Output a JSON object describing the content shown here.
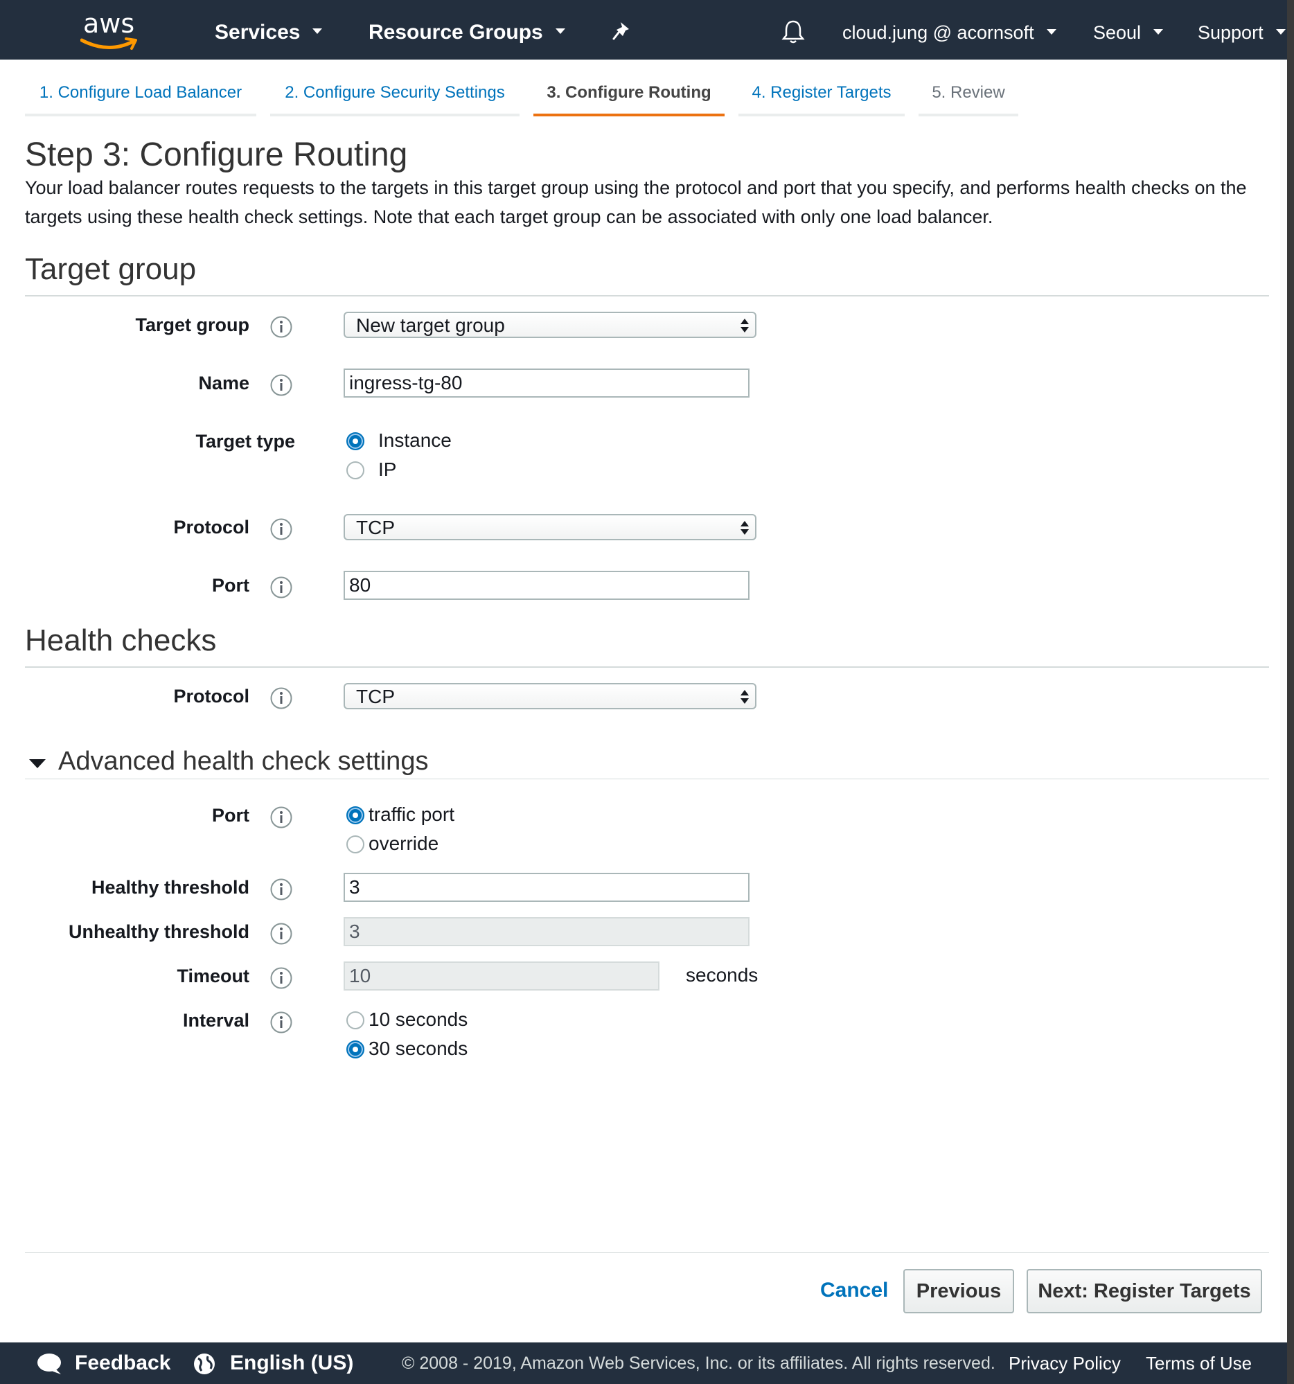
{
  "nav": {
    "logo": "aws",
    "services": "Services",
    "resource_groups": "Resource Groups",
    "account": "cloud.jung @ acornsoft",
    "region": "Seoul",
    "support": "Support"
  },
  "tabs": [
    {
      "label": "1. Configure Load Balancer",
      "state": "link"
    },
    {
      "label": "2. Configure Security Settings",
      "state": "link"
    },
    {
      "label": "3. Configure Routing",
      "state": "active"
    },
    {
      "label": "4. Register Targets",
      "state": "link"
    },
    {
      "label": "5. Review",
      "state": "disabled"
    }
  ],
  "page": {
    "title": "Step 3: Configure Routing",
    "description": "Your load balancer routes requests to the targets in this target group using the protocol and port that you specify, and performs health checks on the targets using these health check settings. Note that each target group can be associated with only one load balancer."
  },
  "target_group": {
    "heading": "Target group",
    "target_group_label": "Target group",
    "target_group_value": "New target group",
    "name_label": "Name",
    "name_value": "ingress-tg-80",
    "target_type_label": "Target type",
    "target_type_options": [
      "Instance",
      "IP"
    ],
    "target_type_selected": "Instance",
    "protocol_label": "Protocol",
    "protocol_value": "TCP",
    "port_label": "Port",
    "port_value": "80"
  },
  "health_checks": {
    "heading": "Health checks",
    "protocol_label": "Protocol",
    "protocol_value": "TCP"
  },
  "advanced": {
    "heading": "Advanced health check settings",
    "port_label": "Port",
    "port_options": [
      "traffic port",
      "override"
    ],
    "port_selected": "traffic port",
    "healthy_label": "Healthy threshold",
    "healthy_value": "3",
    "unhealthy_label": "Unhealthy threshold",
    "unhealthy_value": "3",
    "timeout_label": "Timeout",
    "timeout_value": "10",
    "timeout_unit": "seconds",
    "interval_label": "Interval",
    "interval_options": [
      "10 seconds",
      "30 seconds"
    ],
    "interval_selected": "30 seconds"
  },
  "actions": {
    "cancel": "Cancel",
    "previous": "Previous",
    "next": "Next: Register Targets"
  },
  "footer": {
    "feedback": "Feedback",
    "language": "English (US)",
    "copyright": "© 2008 - 2019, Amazon Web Services, Inc. or its affiliates. All rights reserved.",
    "privacy": "Privacy Policy",
    "terms": "Terms of Use"
  },
  "colors": {
    "nav_bg": "#232f3e",
    "link": "#0073bb",
    "active_tab": "#ec7211",
    "aws_smile": "#ff9900"
  },
  "icons": [
    "chevron-down-icon",
    "pin-icon",
    "bell-icon",
    "info-icon",
    "select-arrows-icon",
    "collapse-triangle-icon",
    "chat-bubble-icon",
    "globe-icon"
  ]
}
